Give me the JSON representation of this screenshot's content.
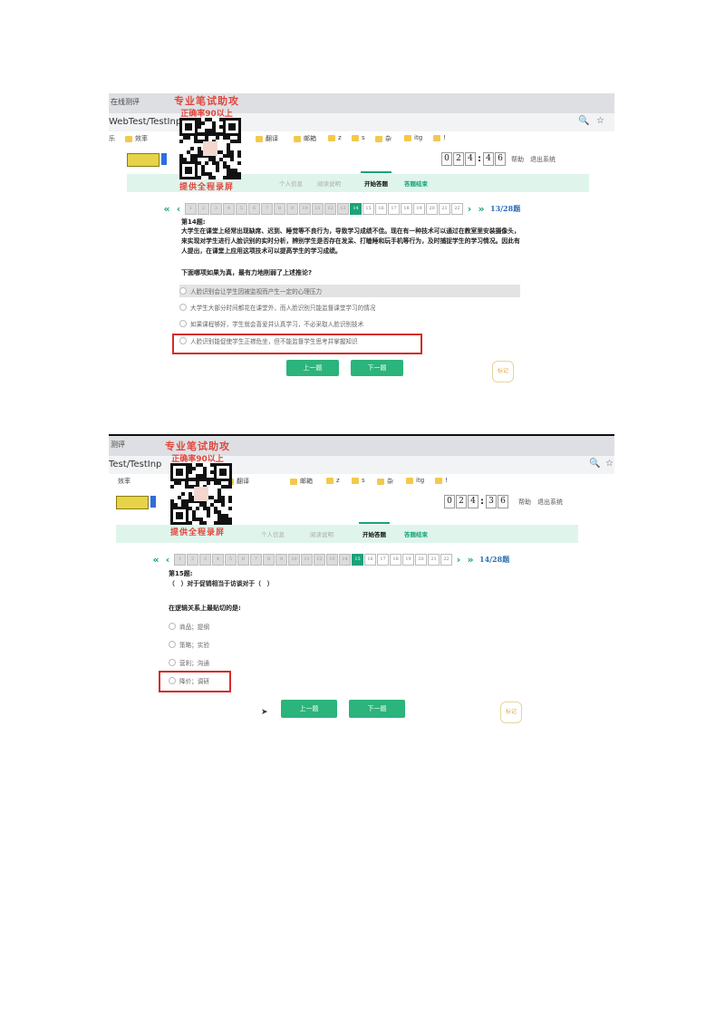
{
  "shots": [
    {
      "tab_title": "在线测评",
      "url": "WebTest/TestInp",
      "bookmarks": [
        "乐",
        "效率",
        "翻译",
        "邮箱",
        "z",
        "s",
        "杂",
        "itg",
        "!"
      ],
      "timer": [
        "0",
        "2",
        "4",
        "4",
        "6"
      ],
      "header_links": [
        "帮助",
        "退出系统"
      ],
      "steps": [
        "个人信息",
        "阅读说明",
        "开始答题",
        "答题结束"
      ],
      "pages": [
        "1",
        "2",
        "3",
        "4",
        "5",
        "6",
        "7",
        "8",
        "9",
        "10",
        "11",
        "12",
        "13",
        "14",
        "15",
        "16",
        "17",
        "18",
        "19",
        "20",
        "21",
        "22"
      ],
      "current_page": "14",
      "counter": "13/28题",
      "question_number": "第14题:",
      "question_text": "大学生在课堂上经常出现缺席、迟到、睡觉等不良行为，导致学习成绩不佳。现在有一种技术可以通过在教室里安装摄像头，来实现对学生进行人脸识别的实时分析，辨别学生是否存在发呆、打瞌睡和玩手机等行为，及时捕捉学生的学习情况。因此有人提出，在课堂上应用这项技术可以提高学生的学习成绩。",
      "prompt": "下面哪项如果为真，最有力地削弱了上述推论?",
      "options": [
        "人脸识别会让学生因被监视而产生一定的心理压力",
        "大学生大部分时间都花在课堂外，而人脸识别只能监督课堂学习的情况",
        "如果课程够好，学生就会喜爱并认真学习，不必采取人脸识别技术",
        "人脸识别能促使学生正襟危坐，但不能监督学生思考并掌握知识"
      ],
      "prev_label": "上一题",
      "next_label": "下一题",
      "mark_label": "标记"
    },
    {
      "tab_title": "测评",
      "url": "Test/TestInp",
      "bookmarks": [
        "效率",
        "翻译",
        "邮箱",
        "z",
        "s",
        "杂",
        "itg",
        "!"
      ],
      "timer": [
        "0",
        "2",
        "4",
        "3",
        "6"
      ],
      "header_links": [
        "帮助",
        "退出系统"
      ],
      "steps": [
        "个人信息",
        "阅读说明",
        "开始答题",
        "答题结束"
      ],
      "pages": [
        "1",
        "2",
        "3",
        "4",
        "5",
        "6",
        "7",
        "8",
        "9",
        "10",
        "11",
        "12",
        "13",
        "14",
        "15",
        "16",
        "17",
        "18",
        "19",
        "20",
        "21",
        "22"
      ],
      "current_page": "15",
      "counter": "14/28题",
      "question_number": "第15题:",
      "question_text": "（　）对于促销相当于访谈对于（　）",
      "prompt": "在逻辑关系上最贴切的是:",
      "options": [
        "商品；提纲",
        "策略；实验",
        "营利；沟通",
        "降价；调研"
      ],
      "prev_label": "上一题",
      "next_label": "下一题",
      "mark_label": "标记"
    }
  ],
  "watermark": {
    "line1": "专业笔试助攻",
    "line2": "正确率90以上",
    "line3": "提供全程录屏"
  },
  "colors": {
    "accent": "#1aa37a",
    "button": "#2bb47b",
    "highlight_box": "#d62b2b",
    "watermark": "#e0473d",
    "step_bar": "#dff5ec"
  }
}
